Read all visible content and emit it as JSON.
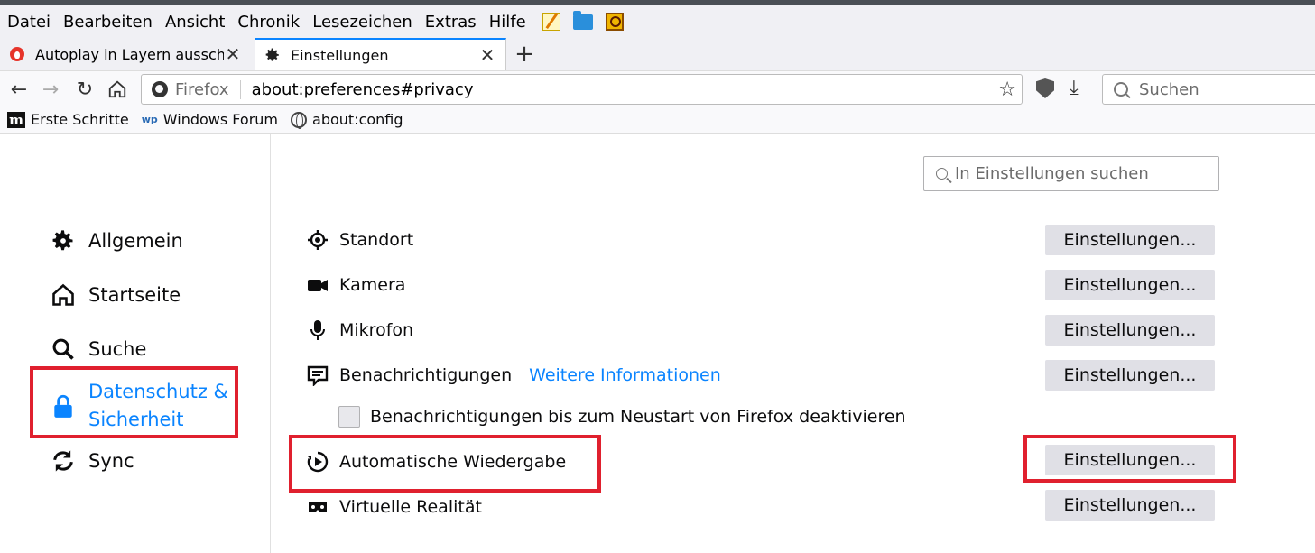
{
  "menubar": {
    "items": [
      "Datei",
      "Bearbeiten",
      "Ansicht",
      "Chronik",
      "Lesezeichen",
      "Extras",
      "Hilfe"
    ],
    "icons": [
      "notepad-icon",
      "folder-icon",
      "search-tool-icon"
    ]
  },
  "tabs": [
    {
      "title": "Autoplay in Layern ausscha",
      "icon": "flame-icon"
    },
    {
      "title": "Einstellungen",
      "icon": "gear-icon",
      "active": true
    }
  ],
  "navbar": {
    "brand": "Firefox",
    "url": "about:preferences#privacy",
    "search_placeholder": "Suchen"
  },
  "bookmarks": [
    {
      "label": "Erste Schritte",
      "icon": "m-icon"
    },
    {
      "label": "Windows Forum",
      "icon": "wp-icon",
      "icon_text": "wp"
    },
    {
      "label": "about:config",
      "icon": "globe-icon"
    }
  ],
  "sidebar": {
    "items": [
      {
        "label": "Allgemein",
        "icon": "gear-icon"
      },
      {
        "label": "Startseite",
        "icon": "home-icon"
      },
      {
        "label": "Suche",
        "icon": "search-icon"
      },
      {
        "label": "Datenschutz &",
        "label2": "Sicherheit",
        "icon": "lock-icon",
        "active": true
      },
      {
        "label": "Sync",
        "icon": "sync-icon"
      }
    ]
  },
  "main": {
    "search_placeholder": "In Einstellungen suchen",
    "permissions": [
      {
        "label": "Standort",
        "icon": "location-icon",
        "button": "Einstellungen..."
      },
      {
        "label": "Kamera",
        "icon": "camera-icon",
        "button": "Einstellungen..."
      },
      {
        "label": "Mikrofon",
        "icon": "microphone-icon",
        "button": "Einstellungen..."
      },
      {
        "label": "Benachrichtigungen",
        "icon": "notification-icon",
        "link": "Weitere Informationen",
        "button": "Einstellungen..."
      },
      {
        "label": "Automatische Wiedergabe",
        "icon": "autoplay-icon",
        "button": "Einstellungen..."
      },
      {
        "label": "Virtuelle Realität",
        "icon": "vr-icon",
        "button": "Einstellungen..."
      }
    ],
    "checkbox_label": "Benachrichtigungen bis zum Neustart von Firefox deaktivieren",
    "highlight_color": "#e0202e",
    "accent_color": "#0a84ff"
  }
}
